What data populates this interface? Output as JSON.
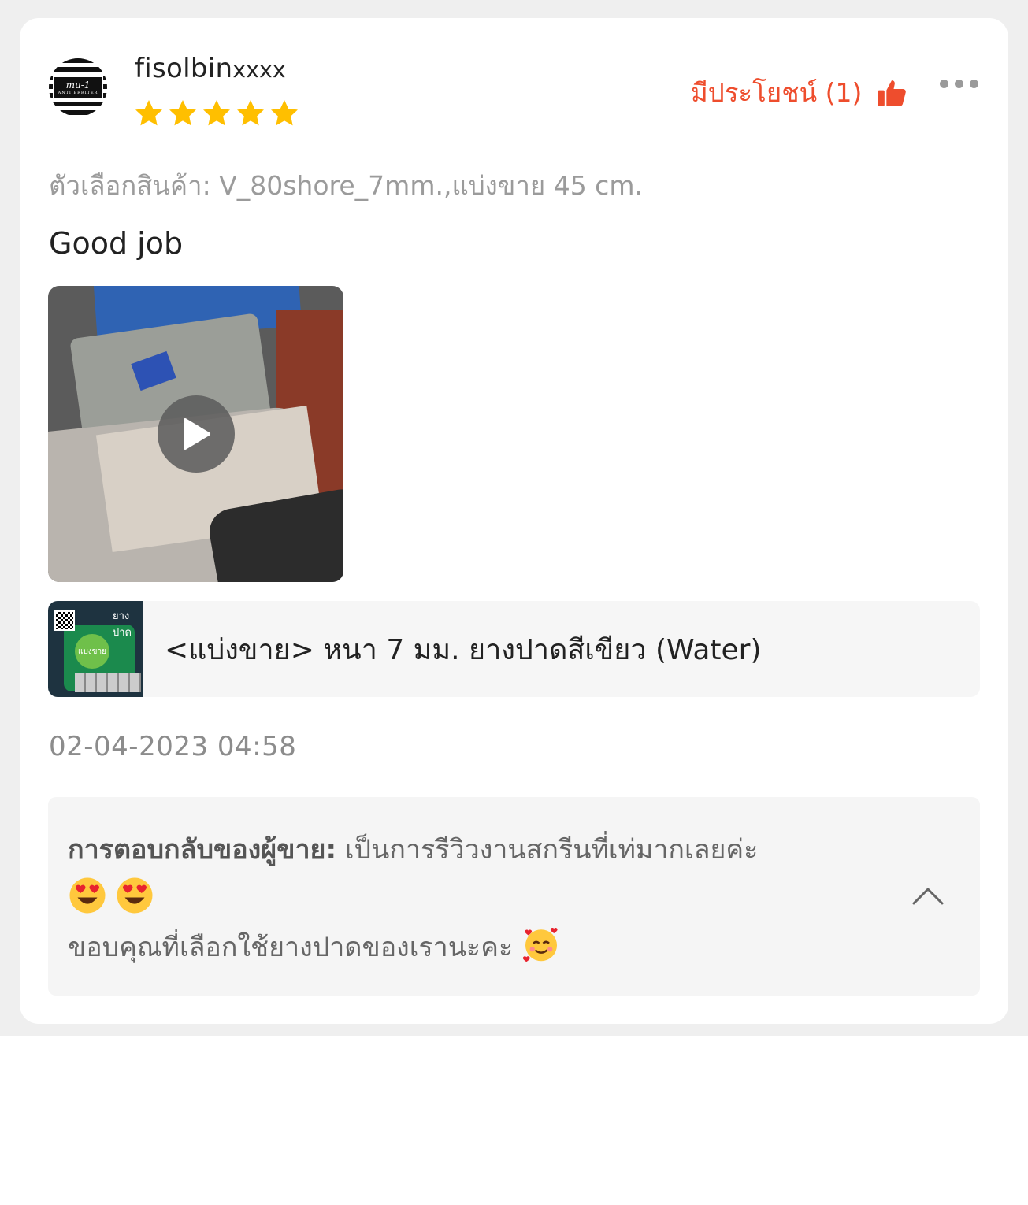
{
  "review": {
    "username_prefix": "fisolbin",
    "username_mask": "xxxx",
    "rating": 5,
    "helpful_label": "มีประโยชน์ (1)",
    "variant": "ตัวเลือกสินค้า: V_80shore_7mm.,แบ่งขาย 45 cm.",
    "text": "Good job",
    "product_name": "<แบ่งขาย> หนา 7 มม. ยางปาดสีเขียว (Water)",
    "product_thumb_label": "ยางปาด",
    "product_thumb_badge": "แบ่งขาย",
    "timestamp": "02-04-2023 04:58"
  },
  "seller_reply": {
    "label": "การตอบกลับของผู้ขาย:",
    "line1": " เป็นการรีวิวงานสกรีนที่เท่มากเลยค่ะ",
    "line3": "ขอบคุณที่เลือกใช้ยางปาดของเรานะคะ"
  },
  "colors": {
    "accent": "#ee4d2d",
    "star": "#ffbf00"
  },
  "icons": [
    "star-icon",
    "thumbs-up-icon",
    "more-icon",
    "play-icon",
    "heart-eyes-emoji",
    "smiling-hearts-emoji",
    "chevron-up-icon"
  ]
}
